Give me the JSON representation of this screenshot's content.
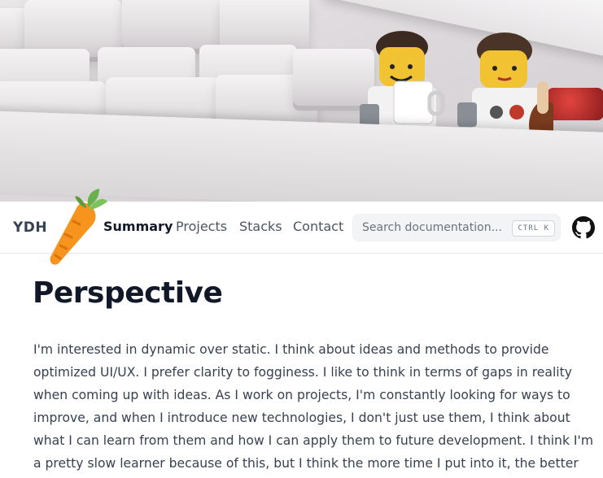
{
  "header": {
    "brand": "YDH",
    "nav": [
      {
        "label": "Summary",
        "active": true
      },
      {
        "label": "Projects",
        "active": false
      },
      {
        "label": "Stacks",
        "active": false
      },
      {
        "label": "Contact",
        "active": false
      }
    ],
    "search": {
      "placeholder": "Search documentation...",
      "shortcut": "CTRL K"
    },
    "github_icon": "github-icon",
    "logo_icon": "carrot-icon"
  },
  "hero": {
    "image": "keyboard-lego-figures-photo"
  },
  "main": {
    "title": "Perspective",
    "body": "I'm interested in dynamic over static. I think about ideas and methods to provide optimized UI/UX. I prefer clarity to fogginess. I like to think in terms of gaps in reality when coming up with ideas. As I work on projects, I'm constantly looking for ways to improve, and when I introduce new technologies, I don't just use them, I think about what I can learn from them and how I can apply them to future development. I think I'm a pretty slow learner because of this, but I think the more time I put into it, the better the outcome."
  },
  "colors": {
    "accent": "#f7941d",
    "leaf": "#6ab04c",
    "text": "#374151",
    "heading": "#111827"
  }
}
